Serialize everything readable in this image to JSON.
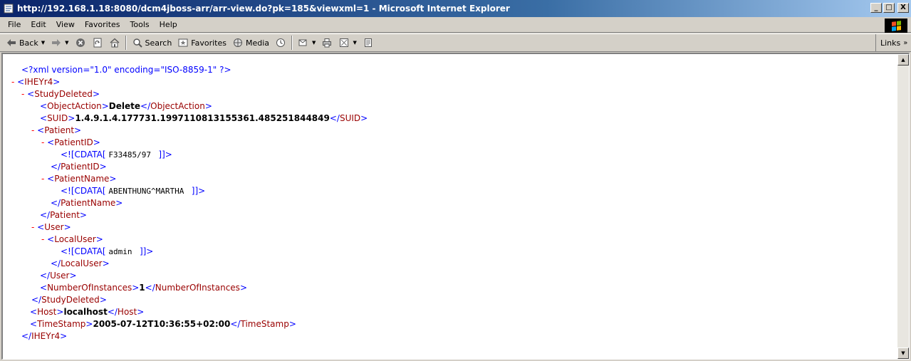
{
  "window": {
    "title": "http://192.168.1.18:8080/dcm4jboss-arr/arr-view.do?pk=185&viewxml=1 - Microsoft Internet Explorer",
    "minimize_label": "_",
    "maximize_label": "□",
    "close_label": "X"
  },
  "menu": {
    "items": [
      "File",
      "Edit",
      "View",
      "Favorites",
      "Tools",
      "Help"
    ]
  },
  "toolbar": {
    "back_label": "Back",
    "search_label": "Search",
    "favorites_label": "Favorites",
    "media_label": "Media",
    "links_label": "Links"
  },
  "xml": {
    "declaration": "<?xml version=\"1.0\" encoding=\"ISO-8859-1\" ?>",
    "root": "IHEYr4",
    "study_deleted": "StudyDeleted",
    "object_action_tag": "ObjectAction",
    "object_action_value": "Delete",
    "suid_tag": "SUID",
    "suid_value": "1.4.9.1.4.177731.1997110813155361.485251844849",
    "patient_tag": "Patient",
    "patient_id_tag": "PatientID",
    "patient_id_cdata": "F33485/97 ",
    "patient_name_tag": "PatientName",
    "patient_name_cdata": "ABENTHUNG^MARTHA ",
    "user_tag": "User",
    "local_user_tag": "LocalUser",
    "local_user_cdata": "admin ",
    "num_instances_tag": "NumberOfInstances",
    "num_instances_value": "1",
    "host_tag": "Host",
    "host_value": "localhost",
    "timestamp_tag": "TimeStamp",
    "timestamp_value": "2005-07-12T10:36:55+02:00",
    "cdata_open": "<![CDATA[",
    "cdata_close": "]]>",
    "collapse_symbol": "-"
  }
}
